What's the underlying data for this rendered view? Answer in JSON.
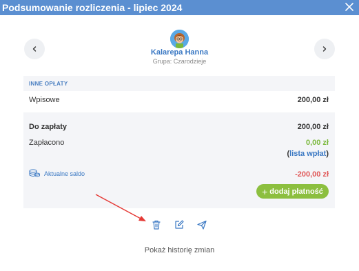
{
  "window": {
    "title": "Podsumowanie rozliczenia - lipiec 2024",
    "close_icon": "close-icon"
  },
  "student": {
    "name": "Kalarepa Hanna",
    "group": "Grupa: Czarodzieje",
    "avatar_icon": "child-avatar"
  },
  "navigation": {
    "prev_icon": "chevron-left-icon",
    "next_icon": "chevron-right-icon"
  },
  "other_fees": {
    "section_label": "INNE OPŁATY",
    "items": [
      {
        "label": "Wpisowe",
        "value": "200,00 zł"
      }
    ]
  },
  "summary": {
    "due_label": "Do zapłaty",
    "due_value": "200,00 zł",
    "paid_label": "Zapłacono",
    "paid_value": "0,00 zł",
    "payments_list_open": "(",
    "payments_list_link": "lista wpłat",
    "payments_list_close": ")",
    "balance_label": "Aktualne saldo",
    "balance_value": "-200,00 zł",
    "balance_icon": "coins-icon"
  },
  "actions": {
    "add_payment_plus": "+",
    "add_payment_label": "dodaj płatność",
    "icons": [
      "trash-icon",
      "edit-icon",
      "send-icon"
    ]
  },
  "footer": {
    "history_link": "Pokaż historię zmian"
  },
  "colors": {
    "titlebar": "#5b8fd1",
    "accent_blue": "#3a78c3",
    "green": "#8cbf3f",
    "red": "#e05656",
    "panel_bg": "#f4f5f8",
    "annotation_arrow": "#e53935"
  }
}
